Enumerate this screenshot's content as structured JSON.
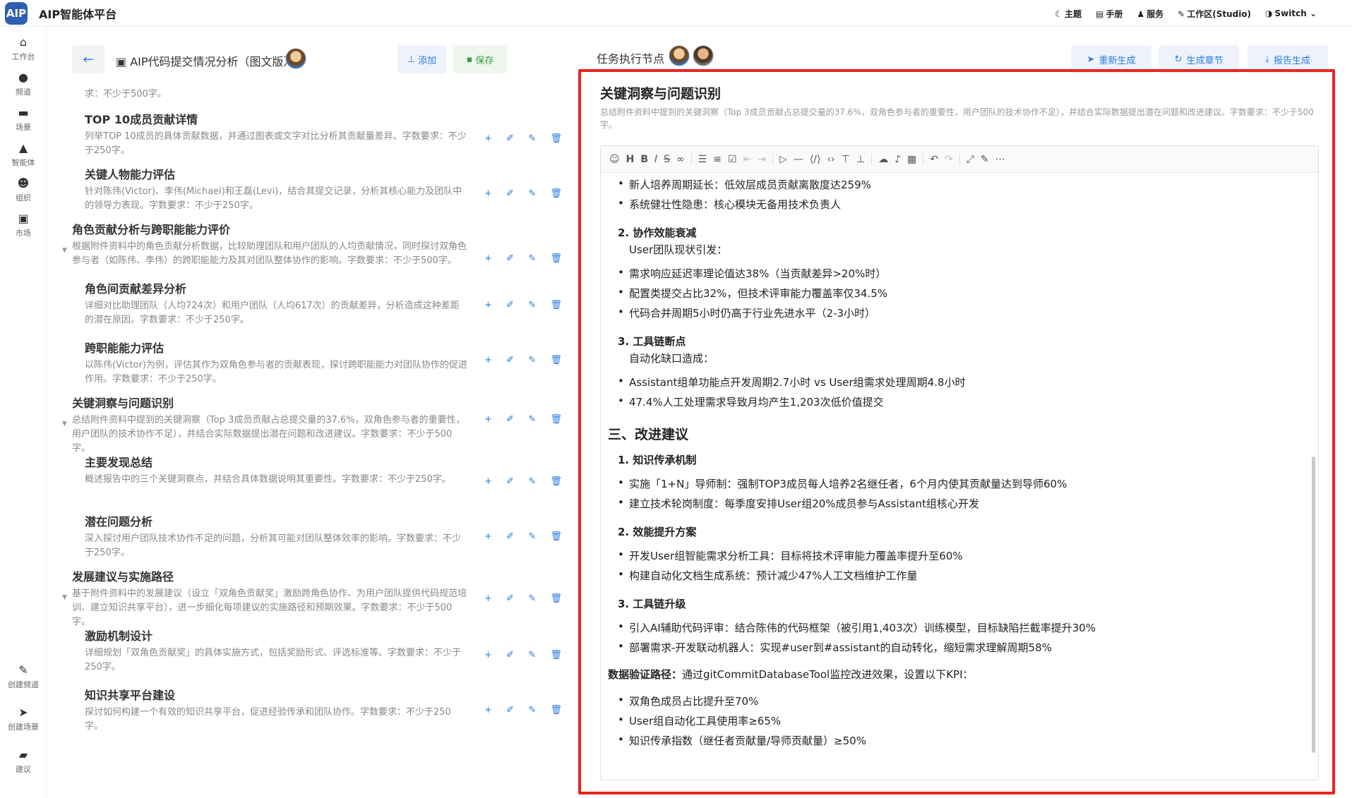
{
  "app": {
    "logo": "AIP",
    "title": "AIP智能体平台"
  },
  "topnav": [
    {
      "icon": "moon-icon",
      "glyph": "☾",
      "label": "主题"
    },
    {
      "icon": "manual-icon",
      "glyph": "▤",
      "label": "手册"
    },
    {
      "icon": "service-icon",
      "glyph": "♟",
      "label": "服务"
    },
    {
      "icon": "pen-icon",
      "glyph": "✎",
      "label": "工作区(Studio)"
    },
    {
      "icon": "shield-icon",
      "glyph": "◑",
      "label": "Switch"
    }
  ],
  "sidebar": {
    "items": [
      {
        "icon": "home-icon",
        "glyph": "⌂",
        "label": "工作台"
      },
      {
        "icon": "user-icon",
        "glyph": "●",
        "label": "频道"
      },
      {
        "icon": "scene-icon",
        "glyph": "▬",
        "label": "场景"
      },
      {
        "icon": "sail-icon",
        "glyph": "▲",
        "label": "智能体"
      },
      {
        "icon": "mask-icon",
        "glyph": "☻",
        "label": "组织"
      },
      {
        "icon": "market-icon",
        "glyph": "▣",
        "label": "市场"
      }
    ],
    "bottom": [
      {
        "icon": "brush-icon",
        "glyph": "✎",
        "label": "创建频道"
      },
      {
        "icon": "plane-icon",
        "glyph": "➤",
        "label": "创建场景"
      },
      {
        "icon": "chat-icon",
        "glyph": "▰",
        "label": "建议"
      }
    ]
  },
  "left": {
    "doc_title": "AIP代码提交情况分析（图文版）",
    "add_label": "添加",
    "save_label": "保存",
    "outline": [
      {
        "level": 2,
        "title": "",
        "desc": "求：不少于500字。"
      },
      {
        "level": 2,
        "title": "TOP 10成员贡献详情",
        "desc": "列举TOP 10成员的具体贡献数据，并通过图表或文字对比分析其贡献量差异。字数要求：不少于250字。"
      },
      {
        "level": 2,
        "title": "关键人物能力评估",
        "desc": "针对陈伟(Victor)、李伟(Michael)和王磊(Levi)，结合其提交记录，分析其核心能力及团队中的领导力表现。字数要求：不少于250字。"
      },
      {
        "level": 1,
        "title": "角色贡献分析与跨职能能力评价",
        "desc": "根据附件资料中的角色贡献分析数据，比较助理团队和用户团队的人均贡献情况，同时探讨双角色参与者（如陈伟、李伟）的跨职能能力及其对团队整体协作的影响。字数要求：不少于500字。"
      },
      {
        "level": 2,
        "title": "角色间贡献差异分析",
        "desc": "详细对比助理团队（人均724次）和用户团队（人均617次）的贡献差异，分析造成这种差距的潜在原因。字数要求：不少于250字。"
      },
      {
        "level": 2,
        "title": "跨职能能力评估",
        "desc": "以陈伟(Victor)为例，评估其作为双角色参与者的贡献表现，探讨跨职能能力对团队协作的促进作用。字数要求：不少于250字。"
      },
      {
        "level": 1,
        "title": "关键洞察与问题识别",
        "desc": "总结附件资料中提到的关键洞察（Top 3成员贡献占总提交量的37.6%，双角色参与者的重要性，用户团队的技术协作不足），并结合实际数据提出潜在问题和改进建议。字数要求：不少于500字。"
      },
      {
        "level": 2,
        "title": "主要发现总结",
        "desc": "概述报告中的三个关键洞察点，并结合具体数据说明其重要性。字数要求：不少于250字。"
      },
      {
        "level": 2,
        "title": "潜在问题分析",
        "desc": "深入探讨用户团队技术协作不足的问题，分析其可能对团队整体效率的影响。字数要求：不少于250字。"
      },
      {
        "level": 1,
        "title": "发展建议与实施路径",
        "desc": "基于附件资料中的发展建议（设立「双角色贡献奖」激励跨角色协作、为用户团队提供代码规范培训、建立知识共享平台），进一步细化每项建议的实施路径和预期效果。字数要求：不少于500字。"
      },
      {
        "level": 2,
        "title": "激励机制设计",
        "desc": "详细规划「双角色贡献奖」的具体实施方式，包括奖励形式、评选标准等。字数要求：不少于250字。"
      },
      {
        "level": 2,
        "title": "知识共享平台建设",
        "desc": "探讨如何构建一个有效的知识共享平台，促进经验传承和团队协作。字数要求：不少于250字。"
      }
    ]
  },
  "right": {
    "task_label": "任务执行节点",
    "regen_label": "重新生成",
    "chapter_label": "生成章节",
    "report_label": "报告生成",
    "section_title": "关键洞察与问题识别",
    "section_desc": "总结附件资料中提到的关键洞察（Top 3成员贡献占总提交量的37.6%，双角色参与者的重要性，用户团队的技术协作不足），并结合实际数据提出潜在问题和改进建议。字数要求：不少于500字。",
    "lines": [
      {
        "t": "bullet",
        "text": "新人培养周期延长：低效层成员贡献离散度达259%"
      },
      {
        "t": "bullet",
        "text": "系统健壮性隐患：核心模块无备用技术负责人"
      },
      {
        "t": "num",
        "text": "2. 协作效能衰减"
      },
      {
        "t": "sub",
        "text": "User团队现状引发："
      },
      {
        "t": "bullet",
        "text": "需求响应延迟率理论值达38%（当贡献差异>20%时）"
      },
      {
        "t": "bullet",
        "text": "配置类提交占比32%，但技术评审能力覆盖率仅34.5%"
      },
      {
        "t": "bullet",
        "text": "代码合并周期5小时仍高于行业先进水平（2-3小时）"
      },
      {
        "t": "num",
        "text": "3. 工具链断点"
      },
      {
        "t": "sub",
        "text": "自动化缺口造成："
      },
      {
        "t": "bullet",
        "text": "Assistant组单功能点开发周期2.7小时 vs User组需求处理周期4.8小时"
      },
      {
        "t": "bullet",
        "text": "47.4%人工处理需求导致月均产生1,203次低价值提交"
      },
      {
        "t": "h2",
        "text": "三、改进建议"
      },
      {
        "t": "num",
        "text": "1. 知识传承机制"
      },
      {
        "t": "bullet",
        "text": "实施「1+N」导师制：强制TOP3成员每人培养2名继任者，6个月内使其贡献量达到导师60%"
      },
      {
        "t": "bullet",
        "text": "建立技术轮岗制度：每季度安排User组20%成员参与Assistant组核心开发"
      },
      {
        "t": "num",
        "text": "2. 效能提升方案"
      },
      {
        "t": "bullet",
        "text": "开发User组智能需求分析工具：目标将技术评审能力覆盖率提升至60%"
      },
      {
        "t": "bullet",
        "text": "构建自动化文档生成系统：预计减少47%人工文档维护工作量"
      },
      {
        "t": "num",
        "text": "3. 工具链升级"
      },
      {
        "t": "bullet",
        "text": "引入AI辅助代码评审：结合陈伟的代码框架（被引用1,403次）训练模型，目标缺陷拦截率提升30%"
      },
      {
        "t": "bullet",
        "text": "部署需求-开发联动机器人：实现#user到#assistant的自动转化，缩短需求理解周期58%"
      },
      {
        "t": "para",
        "bold": "数据验证路径：",
        "text": "通过gitCommitDatabaseTool监控改进效果，设置以下KPI："
      },
      {
        "t": "bullet",
        "text": "双角色成员占比提升至70%"
      },
      {
        "t": "bullet",
        "text": "User组自动化工具使用率≥65%"
      },
      {
        "t": "bullet",
        "text": "知识传承指数（继任者贡献量/导师贡献量）≥50%"
      }
    ]
  },
  "colors": {
    "accent": "#2a7de1",
    "highlight_border": "#e8241f",
    "brand": "#2f5fb3",
    "save_green": "#3aa047"
  }
}
